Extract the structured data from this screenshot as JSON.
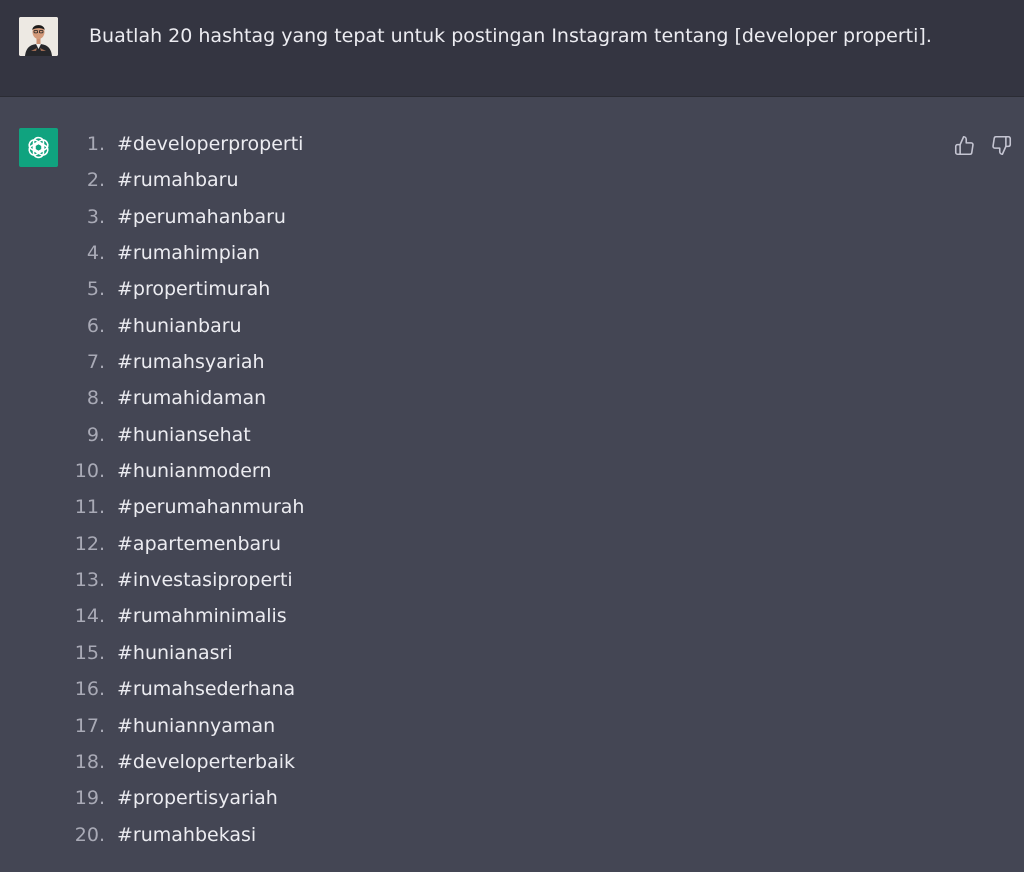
{
  "user_message": {
    "text": "Buatlah 20 hashtag yang tepat untuk postingan Instagram tentang [developer properti]."
  },
  "assistant_message": {
    "items": [
      {
        "num": "1.",
        "text": "#developerproperti"
      },
      {
        "num": "2.",
        "text": "#rumahbaru"
      },
      {
        "num": "3.",
        "text": "#perumahanbaru"
      },
      {
        "num": "4.",
        "text": "#rumahimpian"
      },
      {
        "num": "5.",
        "text": "#propertimurah"
      },
      {
        "num": "6.",
        "text": "#hunianbaru"
      },
      {
        "num": "7.",
        "text": "#rumahsyariah"
      },
      {
        "num": "8.",
        "text": "#rumahidaman"
      },
      {
        "num": "9.",
        "text": "#huniansehat"
      },
      {
        "num": "10.",
        "text": "#hunianmodern"
      },
      {
        "num": "11.",
        "text": "#perumahanmurah"
      },
      {
        "num": "12.",
        "text": "#apartemenbaru"
      },
      {
        "num": "13.",
        "text": "#investasiproperti"
      },
      {
        "num": "14.",
        "text": "#rumahminimalis"
      },
      {
        "num": "15.",
        "text": "#hunianasri"
      },
      {
        "num": "16.",
        "text": "#rumahsederhana"
      },
      {
        "num": "17.",
        "text": "#huniannyaman"
      },
      {
        "num": "18.",
        "text": "#developerterbaik"
      },
      {
        "num": "19.",
        "text": "#propertisyariah"
      },
      {
        "num": "20.",
        "text": "#rumahbekasi"
      }
    ]
  },
  "icons": {
    "user_avatar": "user-avatar-photo",
    "assistant_avatar": "openai-logo-icon",
    "feedback": [
      "thumbs-up-icon",
      "thumbs-down-icon"
    ]
  },
  "colors": {
    "user_background": "#343541",
    "assistant_background": "#444654",
    "assistant_avatar_background": "#10a37f",
    "text": "#ececf1",
    "list_number": "#a9aab6"
  }
}
